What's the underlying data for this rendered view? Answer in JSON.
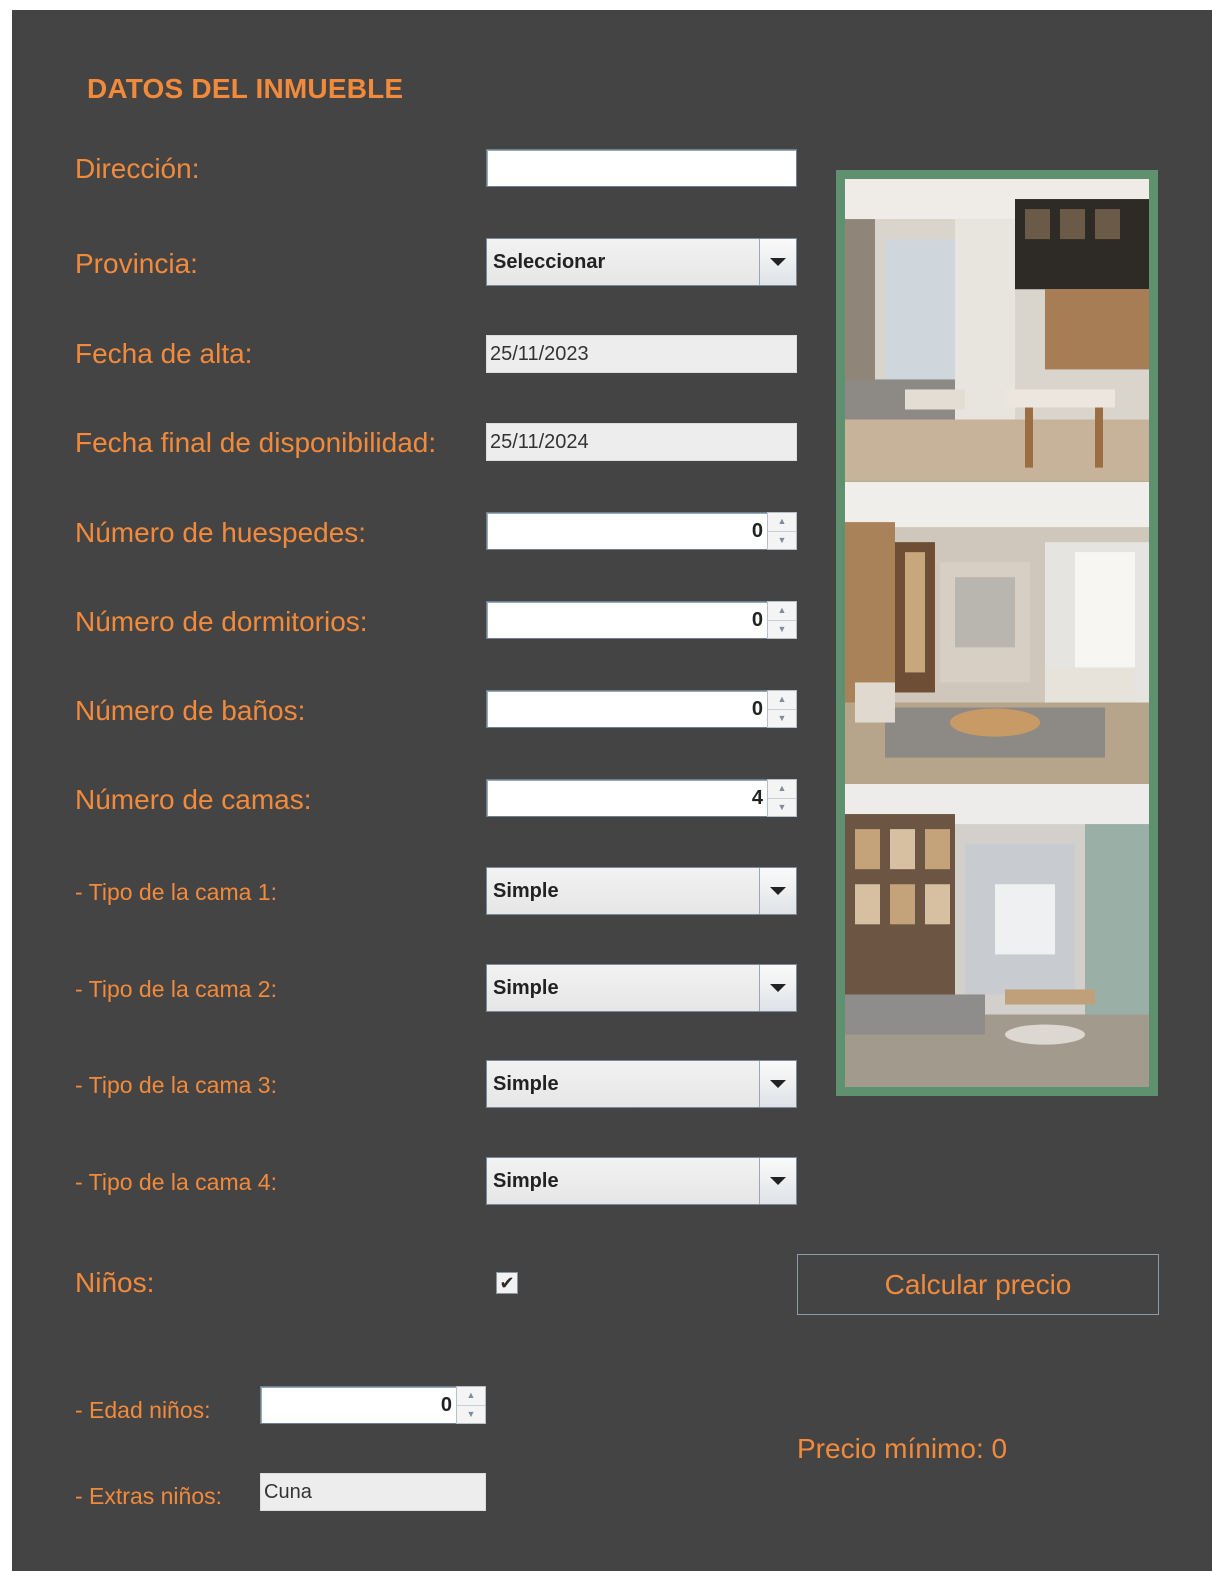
{
  "form": {
    "title": "DATOS DEL INMUEBLE",
    "direccion": {
      "label": "Dirección:",
      "value": ""
    },
    "provincia": {
      "label": "Provincia:",
      "value": "Seleccionar"
    },
    "fecha_alta": {
      "label": "Fecha de alta:",
      "value": "25/11/2023"
    },
    "fecha_final": {
      "label": "Fecha final de disponibilidad:",
      "value": "25/11/2024"
    },
    "huespedes": {
      "label": "Número de huespedes:",
      "value": "0"
    },
    "dormitorios": {
      "label": "Número de dormitorios:",
      "value": "0"
    },
    "banos": {
      "label": "Número de baños:",
      "value": "0"
    },
    "camas": {
      "label": "Número de camas:",
      "value": "4"
    },
    "tipos_cama": [
      {
        "label": "- Tipo de la cama 1:",
        "value": "Simple"
      },
      {
        "label": "- Tipo de la cama 2:",
        "value": "Simple"
      },
      {
        "label": "- Tipo de la cama 3:",
        "value": "Simple"
      },
      {
        "label": "- Tipo de la cama 4:",
        "value": "Simple"
      }
    ],
    "ninos": {
      "label": "Niños:",
      "checked": true,
      "check_glyph": "✔"
    },
    "edad_ninos": {
      "label": "- Edad niños:",
      "value": "0"
    },
    "extras_ninos": {
      "label": "- Extras niños:",
      "value": "Cuna"
    }
  },
  "actions": {
    "calcular_label": "Calcular precio"
  },
  "result": {
    "precio_minimo": "Precio mínimo: 0"
  },
  "spinner": {
    "up": "▲",
    "down": "▼"
  },
  "gallery": {
    "photos": [
      "interior-photo-1",
      "interior-photo-2",
      "interior-photo-3"
    ]
  },
  "colors": {
    "background": "#444444",
    "accent": "#f28a3c",
    "gallery_border": "#5f9070"
  }
}
